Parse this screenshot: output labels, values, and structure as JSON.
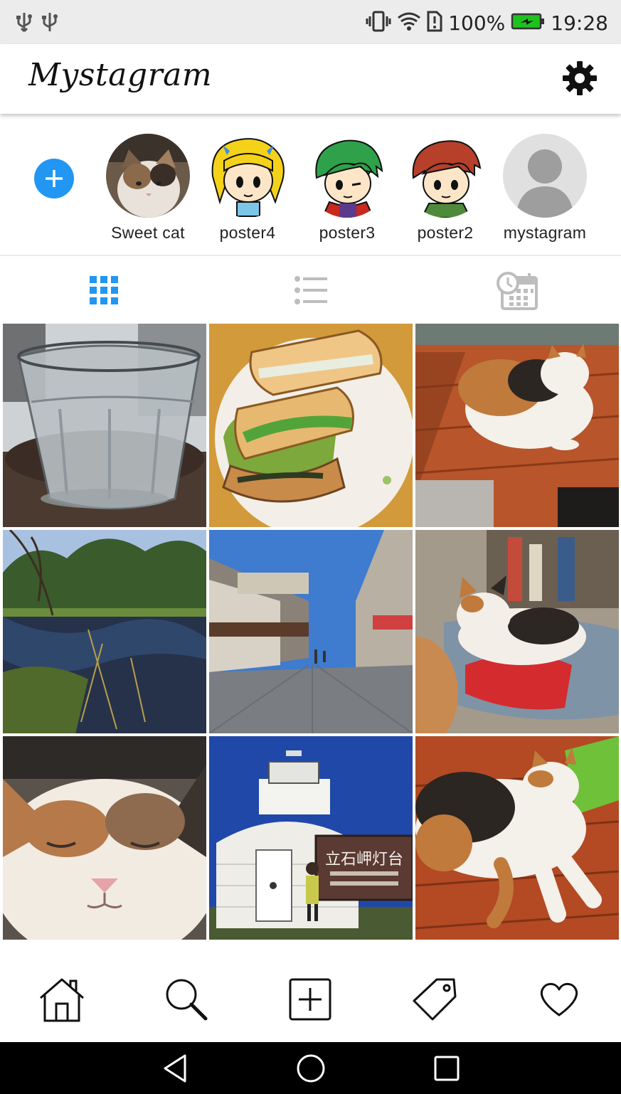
{
  "status_bar": {
    "battery_text": "100%",
    "time": "19:28",
    "icons": [
      "usb-icon",
      "usb-icon",
      "vibrate-icon",
      "wifi-icon",
      "sim-alert-icon",
      "battery-charging-icon"
    ]
  },
  "app_bar": {
    "title": "Mystagram",
    "settings_icon": "gear-icon"
  },
  "stories": {
    "add_icon": "plus-icon",
    "add_color": "#2196f3",
    "items": [
      {
        "label": "Sweet cat",
        "avatar": "cat-photo"
      },
      {
        "label": "poster4",
        "avatar": "blonde-girl-avatar"
      },
      {
        "label": "poster3",
        "avatar": "green-hair-boy-avatar"
      },
      {
        "label": "poster2",
        "avatar": "red-hair-boy-avatar"
      },
      {
        "label": "mystagram",
        "avatar": "default-user-avatar"
      }
    ]
  },
  "tabs": {
    "active_color": "#2196f3",
    "inactive_color": "#bdbdbd",
    "items": [
      {
        "icon": "grid-icon",
        "active": true
      },
      {
        "icon": "list-icon",
        "active": false
      },
      {
        "icon": "calendar-history-icon",
        "active": false
      }
    ]
  },
  "photos": [
    {
      "subject": "glass-of-water"
    },
    {
      "subject": "sandwich-plate"
    },
    {
      "subject": "calico-cat-on-table"
    },
    {
      "subject": "pond-landscape"
    },
    {
      "subject": "old-street"
    },
    {
      "subject": "cat-on-red-cushion"
    },
    {
      "subject": "cat-face-closeup"
    },
    {
      "subject": "lighthouse",
      "sign_text": "立石岬灯台"
    },
    {
      "subject": "cat-lying-down"
    }
  ],
  "bottom_nav": {
    "items": [
      "home-icon",
      "search-icon",
      "add-post-icon",
      "tag-icon",
      "heart-icon"
    ]
  },
  "system_nav": {
    "items": [
      "back-icon",
      "home-circle-icon",
      "recents-icon"
    ]
  }
}
